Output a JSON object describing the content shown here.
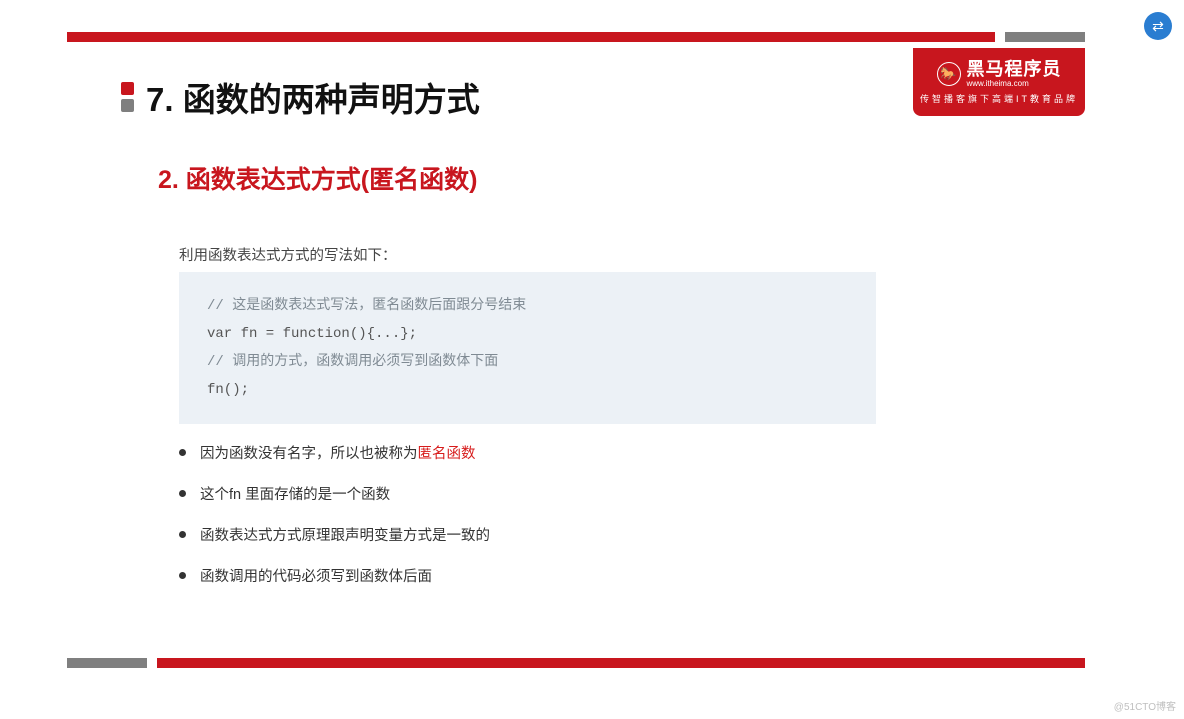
{
  "floating_button_icon": "⇄",
  "logo": {
    "title": "黑马程序员",
    "url": "www.itheima.com",
    "slogan": "传智播客旗下高端IT教育品牌",
    "horse": "🐎"
  },
  "main_title": "7. 函数的两种声明方式",
  "subtitle": "2.  函数表达式方式(匿名函数)",
  "description": "利用函数表达式方式的写法如下：",
  "code": {
    "line1_comment": "// 这是函数表达式写法，匿名函数后面跟分号结束",
    "line2": "var fn = function(){...};",
    "line3_comment": "// 调用的方式，函数调用必须写到函数体下面",
    "line4": "fn();"
  },
  "bullets": [
    {
      "prefix": "因为函数没有名字，所以也被称为",
      "highlight": "匿名函数",
      "suffix": ""
    },
    {
      "prefix": "这个fn 里面存储的是一个函数",
      "highlight": "",
      "suffix": ""
    },
    {
      "prefix": "函数表达式方式原理跟声明变量方式是一致的",
      "highlight": "",
      "suffix": ""
    },
    {
      "prefix": "函数调用的代码必须写到函数体后面",
      "highlight": "",
      "suffix": ""
    }
  ],
  "watermark": "@51CTO博客"
}
